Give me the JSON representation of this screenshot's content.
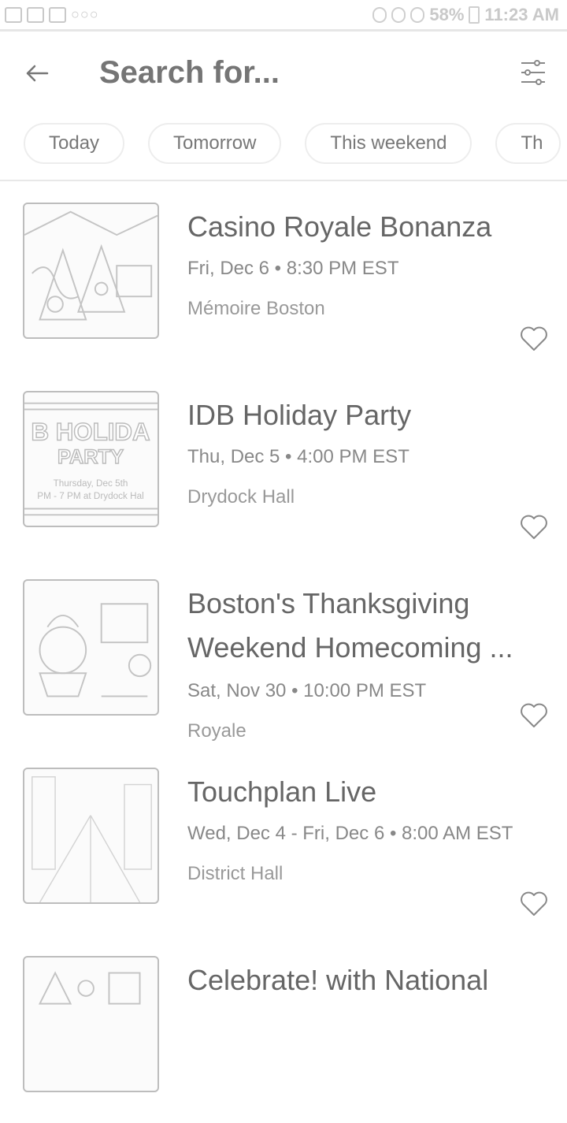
{
  "status_bar": {
    "battery": "58%",
    "time": "11:23 AM"
  },
  "search": {
    "placeholder": "Search for..."
  },
  "chips": [
    "Today",
    "Tomorrow",
    "This weekend",
    "Th"
  ],
  "events": [
    {
      "title": "Casino Royale Bonanza",
      "date": "Fri, Dec 6 • 8:30 PM EST",
      "venue": "Mémoire Boston"
    },
    {
      "title": "IDB Holiday Party",
      "date": "Thu, Dec 5 • 4:00 PM EST",
      "venue": "Drydock Hall",
      "thumb": {
        "line1": "B HOLIDA",
        "line2": "PARTY",
        "line3": "Thursday, Dec 5th",
        "line4": "PM - 7 PM at Drydock Hal"
      }
    },
    {
      "title": "Boston's Thanksgiving Weekend Homecoming ...",
      "date": "Sat, Nov 30 • 10:00 PM EST",
      "venue": "Royale"
    },
    {
      "title": "Touchplan Live",
      "date": "Wed, Dec 4 - Fri, Dec 6 • 8:00 AM EST",
      "venue": "District Hall"
    },
    {
      "title": "Celebrate! with National",
      "date": "",
      "venue": ""
    }
  ],
  "icons": {
    "back": "arrow-left-icon",
    "filter": "sliders-icon",
    "favorite": "heart-outline-icon"
  },
  "colors": {
    "text": "#666666",
    "muted": "#999999",
    "border": "#e8e8e8"
  }
}
